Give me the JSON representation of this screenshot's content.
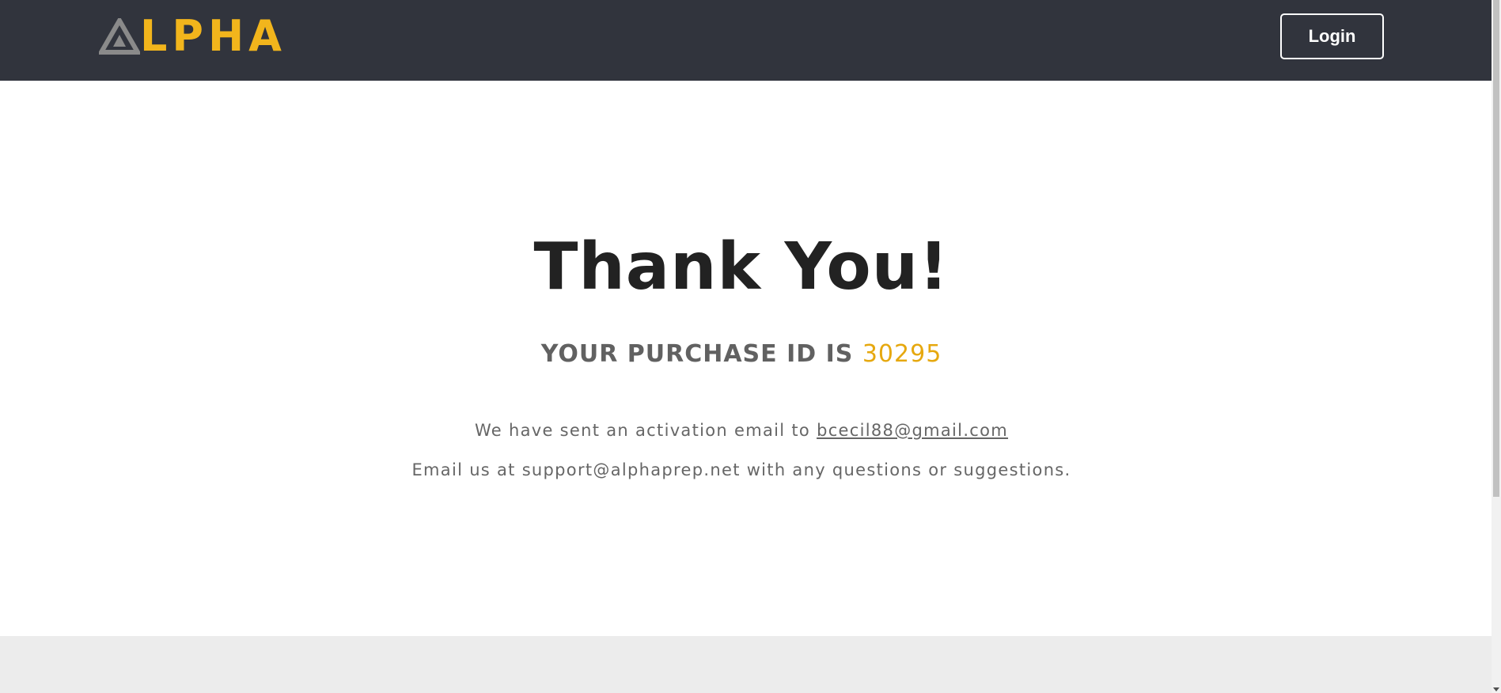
{
  "header": {
    "logo_text": "LPHA",
    "logo_icon": "alpha-triangle-icon",
    "login_label": "Login"
  },
  "main": {
    "title": "Thank You!",
    "purchase_label": "YOUR PURCHASE ID IS",
    "purchase_id": "30295",
    "activation_prefix": "We have sent an activation email to",
    "activation_email": "bcecil88@gmail.com",
    "support_message": "Email us at support@alphaprep.net with any questions or suggestions."
  },
  "colors": {
    "header_bg": "#31343d",
    "brand_accent": "#f2b51c",
    "purchase_id": "#e6a80f",
    "title_text": "#222222",
    "body_text": "#666666",
    "footer_bg": "#ececec"
  }
}
